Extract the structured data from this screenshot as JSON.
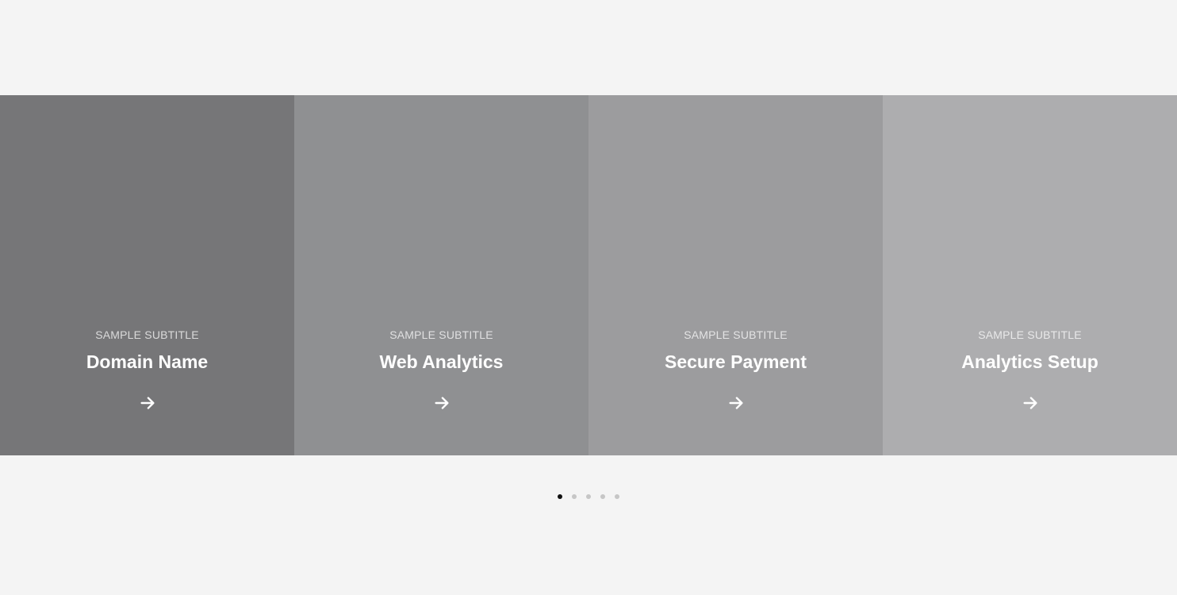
{
  "slides": [
    {
      "subtitle": "SAMPLE SUBTITLE",
      "title": "Domain Name",
      "bg": "#767678",
      "arrow_icon": "arrow-right-icon"
    },
    {
      "subtitle": "SAMPLE SUBTITLE",
      "title": "Web Analytics",
      "bg": "#8f9092",
      "arrow_icon": "arrow-right-icon"
    },
    {
      "subtitle": "SAMPLE SUBTITLE",
      "title": "Secure Payment",
      "bg": "#9c9c9e",
      "arrow_icon": "arrow-right-icon"
    },
    {
      "subtitle": "SAMPLE SUBTITLE",
      "title": "Analytics Setup",
      "bg": "#adadaf",
      "arrow_icon": "arrow-right-icon"
    }
  ],
  "pagination": {
    "count": 5,
    "active_index": 0,
    "active_color": "#111111",
    "inactive_color": "#c6c6c6"
  },
  "page_background": "#f4f4f4"
}
